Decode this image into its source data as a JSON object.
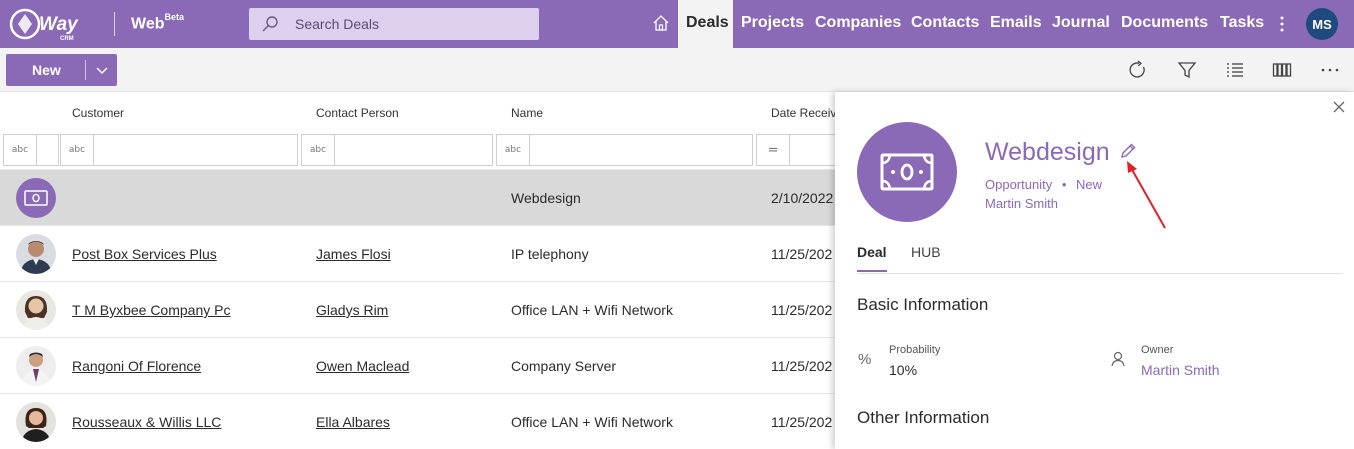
{
  "app": {
    "logo_text": "eWay CRM",
    "name": "Web",
    "badge": "Beta"
  },
  "search": {
    "placeholder": "Search Deals"
  },
  "nav": {
    "items": [
      {
        "label": "Deals",
        "active": true
      },
      {
        "label": "Projects"
      },
      {
        "label": "Companies"
      },
      {
        "label": "Contacts"
      },
      {
        "label": "Emails"
      },
      {
        "label": "Journal"
      },
      {
        "label": "Documents"
      },
      {
        "label": "Tasks"
      }
    ]
  },
  "user": {
    "initials": "MS"
  },
  "toolbar": {
    "new_label": "New"
  },
  "grid": {
    "columns": [
      "Customer",
      "Contact Person",
      "Name",
      "Date Receive"
    ],
    "filter_types": [
      "abc",
      "abc",
      "abc",
      "="
    ],
    "rows": [
      {
        "customer": "",
        "contact": "",
        "name": "Webdesign",
        "date": "2/10/2022",
        "selected": true
      },
      {
        "customer": "Post Box Services Plus",
        "contact": "James Flosi",
        "name": "IP telephony",
        "date": "11/25/202"
      },
      {
        "customer": "T M Byxbee Company Pc",
        "contact": "Gladys Rim",
        "name": "Office LAN + Wifi Network",
        "date": "11/25/202"
      },
      {
        "customer": "Rangoni Of Florence",
        "contact": "Owen Maclead",
        "name": "Company Server",
        "date": "11/25/202"
      },
      {
        "customer": "Rousseaux & Willis LLC",
        "contact": "Ella Albares",
        "name": "Office LAN + Wifi Network",
        "date": "11/25/202"
      }
    ]
  },
  "detail": {
    "title": "Webdesign",
    "type": "Opportunity",
    "status": "New",
    "owner": "Martin Smith",
    "tabs": [
      "Deal",
      "HUB"
    ],
    "basic_info_title": "Basic Information",
    "probability_label": "Probability",
    "probability_value": "10%",
    "owner_label": "Owner",
    "owner_value": "Martin Smith",
    "other_info_title": "Other Information"
  },
  "colors": {
    "accent": "#8a6ab7",
    "avatar": "#1f4a80",
    "annotation_arrow": "#e0202a"
  }
}
